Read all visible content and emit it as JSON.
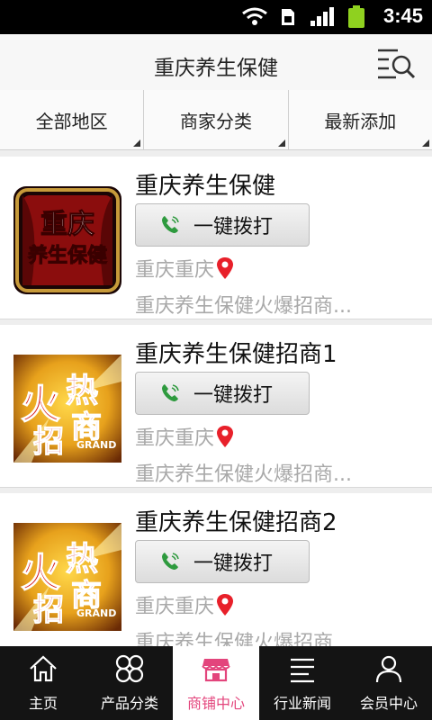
{
  "status_bar": {
    "time": "3:45"
  },
  "header": {
    "title": "重庆养生保健",
    "menu_icon": "search-list-icon"
  },
  "filters": [
    {
      "label": "全部地区"
    },
    {
      "label": "商家分类"
    },
    {
      "label": "最新添加"
    }
  ],
  "listings": [
    {
      "name": "重庆养生保健",
      "call_label": "一键拨打",
      "location": "重庆重庆",
      "description": "重庆养生保健火爆招商...",
      "image": "logo-red-banner"
    },
    {
      "name": "重庆养生保健招商1",
      "call_label": "一键拨打",
      "location": "重庆重庆",
      "description": "重庆养生保健火爆招商...",
      "image": "hot-recruit-poster",
      "image_text": "火热招商"
    },
    {
      "name": "重庆养生保健招商2",
      "call_label": "一键拨打",
      "location": "重庆重庆",
      "description": "重庆养生保健火爆招商...",
      "image": "hot-recruit-poster",
      "image_text": "火热招商"
    }
  ],
  "logo_text": {
    "line1": "重庆",
    "line2": "养生保健"
  },
  "tabs": [
    {
      "label": "主页",
      "icon": "home-icon",
      "active": false
    },
    {
      "label": "产品分类",
      "icon": "grid-icon",
      "active": false
    },
    {
      "label": "商铺中心",
      "icon": "shop-icon",
      "active": true
    },
    {
      "label": "行业新闻",
      "icon": "news-icon",
      "active": false
    },
    {
      "label": "会员中心",
      "icon": "user-icon",
      "active": false
    }
  ],
  "colors": {
    "accent": "#e3457c",
    "call_icon": "#2e9a3e",
    "pin": "#e8202a",
    "tabbar": "#141414"
  }
}
